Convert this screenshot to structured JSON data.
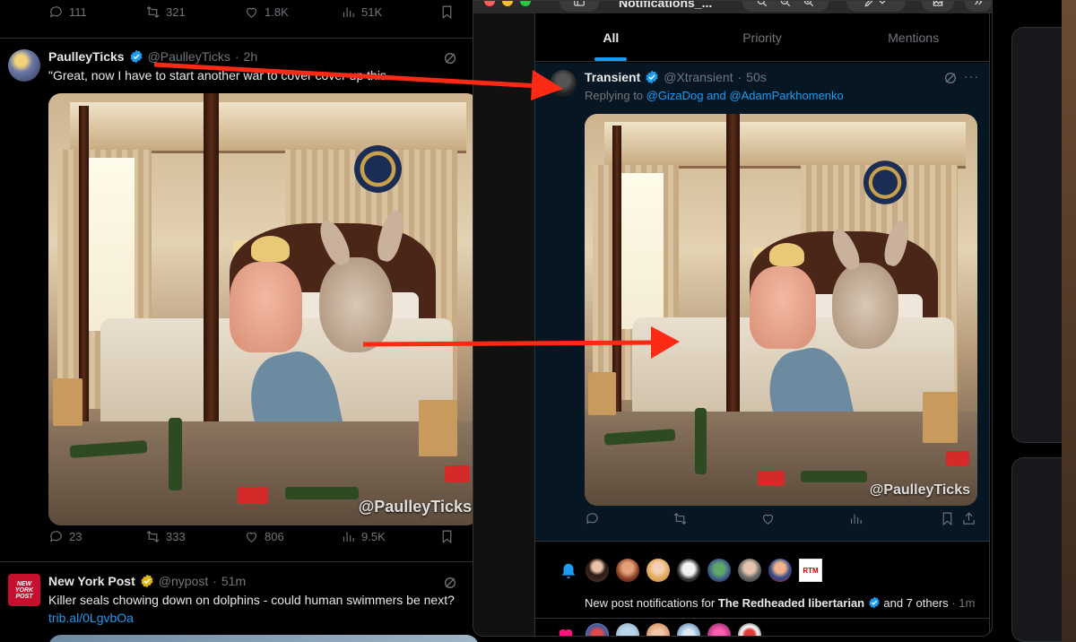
{
  "left_timeline": {
    "prev_tweet_actions": {
      "replies": "111",
      "reposts": "321",
      "likes": "1.8K",
      "views": "51K"
    },
    "tweet1": {
      "name": "PaulleyTicks",
      "handle": "@PaulleyTicks",
      "dot": "·",
      "time": "2h",
      "text": "\"Great, now I have to start another war to cover cover up this",
      "watermark": "@PaulleyTicks",
      "actions": {
        "replies": "23",
        "reposts": "333",
        "likes": "806",
        "views": "9.5K"
      }
    },
    "tweet2": {
      "name": "New York Post",
      "handle": "@nypost",
      "dot": "·",
      "time": "51m",
      "avatar_text": "NEW YORK POST",
      "text": "Killer seals chowing down on dolphins - could human swimmers be next?",
      "link": "trib.al/0LgvbOa"
    }
  },
  "window": {
    "title": "Notifications_...",
    "tabs": [
      {
        "label": "All",
        "active": true
      },
      {
        "label": "Priority",
        "active": false
      },
      {
        "label": "Mentions",
        "active": false
      }
    ],
    "post": {
      "name": "Transient",
      "handle": "@Xtransient",
      "dot": "·",
      "time": "50s",
      "replying_prefix": "Replying to",
      "mention1": "@GizaDog",
      "and_word": "and",
      "mention2": "@AdamParkhomenko",
      "more": "···",
      "watermark": "@PaulleyTicks"
    },
    "group_notification": {
      "prefix": "New post notifications for",
      "account": "The Redheaded libertarian",
      "suffix": "and 7 others",
      "dot": "·",
      "time": "1m",
      "rtm_label": "RTM"
    }
  },
  "colors": {
    "accent": "#1d9bf0",
    "verified": "#1d9bf0",
    "verified_gold": "#e2b719",
    "arrow": "#ff2a14",
    "text": "#e7e9ea",
    "muted": "#71767b"
  }
}
